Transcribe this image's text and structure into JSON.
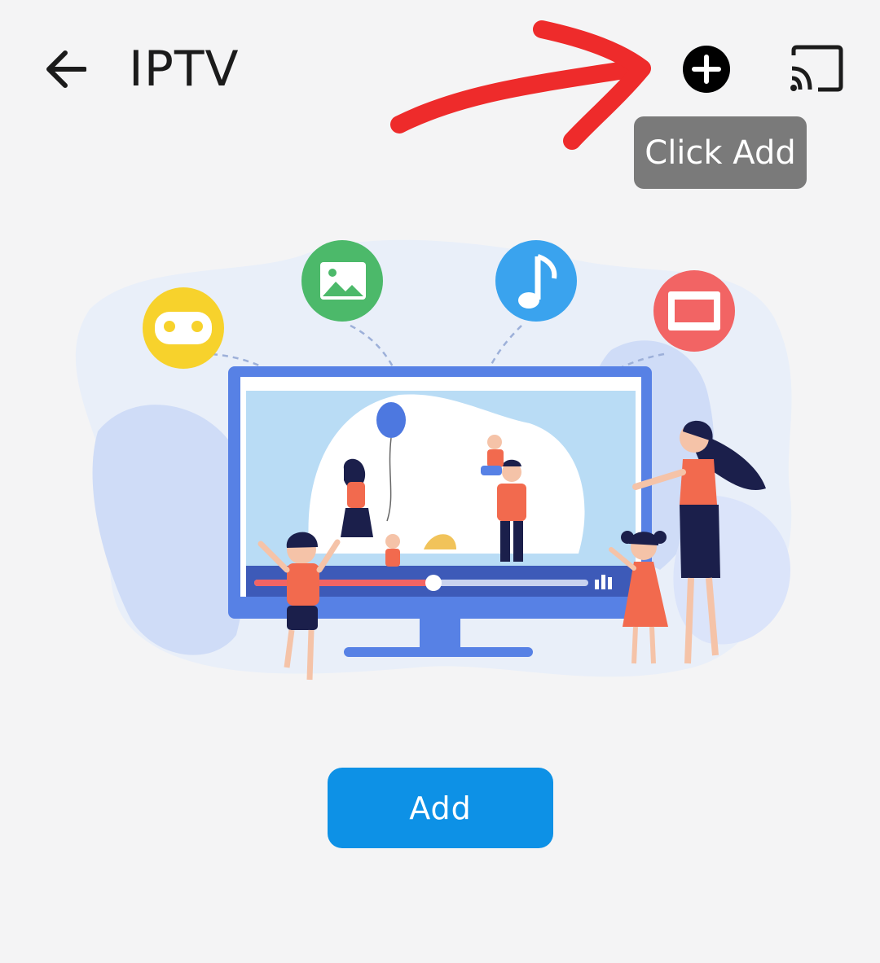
{
  "header": {
    "title": "IPTV",
    "back_icon": "arrow-left-icon",
    "add_icon": "plus-circle-icon",
    "cast_icon": "cast-icon"
  },
  "annotation": {
    "tooltip_text": "Click Add",
    "arrow_color": "#ee2b2b"
  },
  "illustration": {
    "media_icons": [
      "gamepad-icon",
      "image-icon",
      "music-icon",
      "film-icon"
    ],
    "media_colors": [
      "#f7d22c",
      "#4cb96a",
      "#3aa3ee",
      "#f26464"
    ]
  },
  "main": {
    "add_button_label": "Add",
    "accent": "#0d91e6"
  }
}
